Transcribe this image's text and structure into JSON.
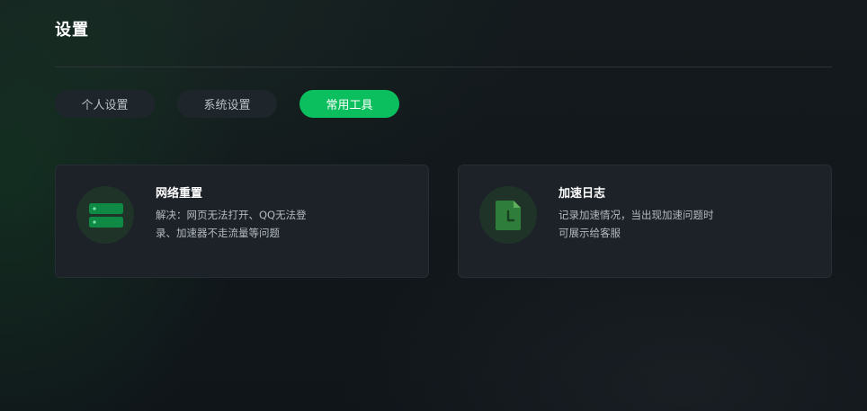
{
  "page": {
    "title": "设置"
  },
  "tabs": [
    {
      "label": "个人设置",
      "active": false
    },
    {
      "label": "系统设置",
      "active": false
    },
    {
      "label": "常用工具",
      "active": true
    }
  ],
  "tools": [
    {
      "title": "网络重置",
      "desc_line1": "解决：网页无法打开、QQ无法登",
      "desc_line2": "录、加速器不走流量等问题",
      "icon": "server-icon"
    },
    {
      "title": "加速日志",
      "desc_line1": "记录加速情况，当出现加速问题时",
      "desc_line2": "可展示给客服",
      "icon": "log-file-icon"
    }
  ],
  "colors": {
    "accent": "#0bbf5e",
    "background": "#121619",
    "card": "#1c2228",
    "tab_inactive": "#1e252b"
  }
}
